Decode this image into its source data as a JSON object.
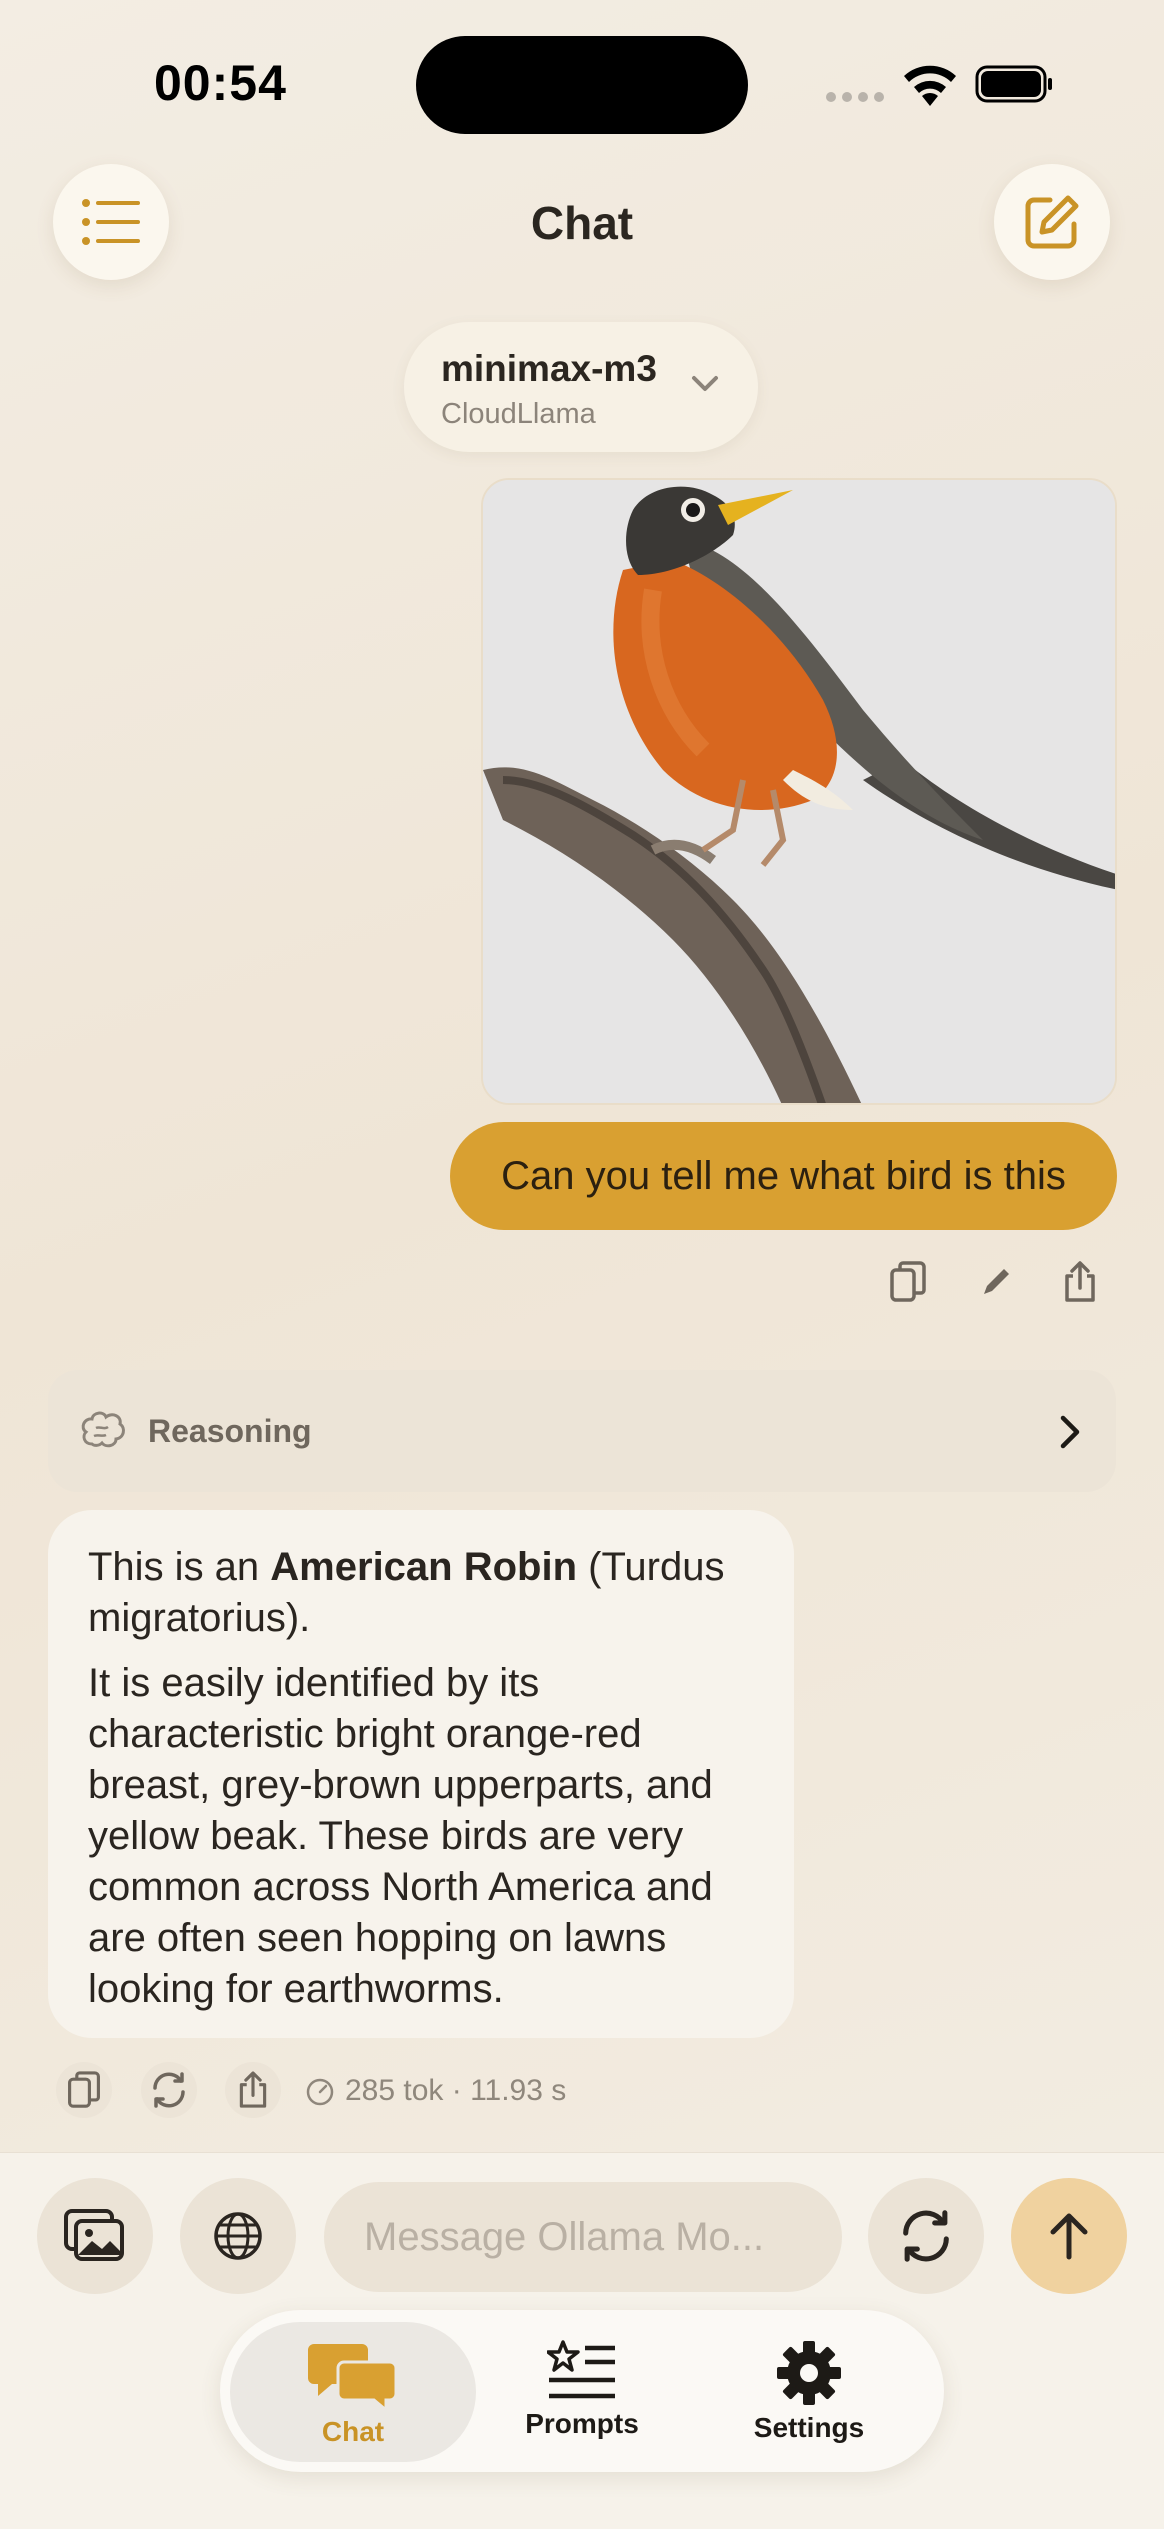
{
  "status_bar": {
    "time": "00:54"
  },
  "header": {
    "title": "Chat"
  },
  "model": {
    "name": "minimax-m3",
    "provider": "CloudLlama"
  },
  "user_message": {
    "text": "Can you tell me what bird is this"
  },
  "reasoning": {
    "label": "Reasoning"
  },
  "assistant_message": {
    "p1_start": "This is an ",
    "p1_bold": "American Robin",
    "p1_end": " (Turdus migratorius).",
    "p2": "It is easily identified by its characteristic bright orange-red breast, grey-brown upperparts, and yellow beak. These birds are very common across North America and are often seen hopping on lawns looking for earthworms."
  },
  "stats": {
    "text": "285 tok · 11.93 s"
  },
  "composer": {
    "placeholder": "Message Ollama Mo..."
  },
  "tabs": [
    {
      "label": "Chat",
      "icon": "chat-bubbles-icon",
      "active": true
    },
    {
      "label": "Prompts",
      "icon": "prompts-list-icon",
      "active": false
    },
    {
      "label": "Settings",
      "icon": "gear-icon",
      "active": false
    }
  ],
  "colors": {
    "accent": "#d9a031",
    "background": "#f1e9dc"
  }
}
